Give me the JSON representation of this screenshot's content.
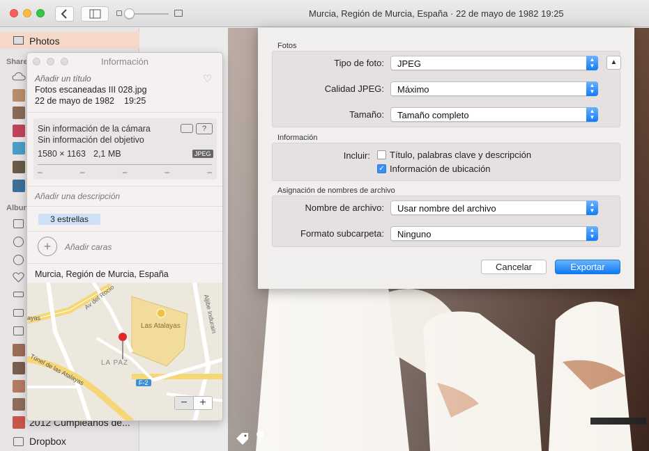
{
  "window": {
    "title": "Murcia, Región de Murcia, España  ·  22 de mayo de 1982 19:25"
  },
  "sidebar": {
    "photos_label": "Photos",
    "shared_heading": "Share",
    "albums_heading": "Albun",
    "birthday_album": "2012 Cumpleaños de...",
    "dropbox_label": "Dropbox"
  },
  "info": {
    "panel_title": "Información",
    "add_title_placeholder": "Añadir un título",
    "filename": "Fotos escaneadas III 028.jpg",
    "date": "22 de mayo de 1982",
    "time": "19:25",
    "no_camera": "Sin información de la cámara",
    "no_lens": "Sin información del objetivo",
    "dimensions": "1580 × 1163",
    "file_size": "2,1 MB",
    "format_badge": "JPEG",
    "camera_help": "?",
    "dashes": [
      "–",
      "–",
      "–",
      "–",
      "–"
    ],
    "add_description": "Añadir una descripción",
    "rating": "3 estrellas",
    "add_faces": "Añadir caras",
    "location": "Murcia, Región de Murcia, España",
    "map": {
      "street_1": "Av del Rocío",
      "street_2": "Aljibe Indurain",
      "place": "Las Atalayas",
      "district": "LA PAZ",
      "tunnel": "Túnel de las Atalayas",
      "road_badge": "F-2",
      "side_label": "ayas",
      "zoom_out": "−",
      "zoom_in": "+"
    }
  },
  "export": {
    "section_photos": "Fotos",
    "photo_type_label": "Tipo de foto:",
    "photo_type_value": "JPEG",
    "quality_label": "Calidad JPEG:",
    "quality_value": "Máximo",
    "size_label": "Tamaño:",
    "size_value": "Tamaño completo",
    "section_info": "Información",
    "include_label": "Incluir:",
    "include_title": "Título, palabras clave y descripción",
    "include_title_checked": false,
    "include_location": "Información de ubicación",
    "include_location_checked": true,
    "section_naming": "Asignación de nombres de archivo",
    "filename_label": "Nombre de archivo:",
    "filename_value": "Usar nombre del archivo",
    "subfolder_label": "Formato subcarpeta:",
    "subfolder_value": "Ninguno",
    "cancel_button": "Cancelar",
    "export_button": "Exportar"
  },
  "colors": {
    "accent": "#137bf5",
    "sidebar_selection": "#f5d8c8"
  }
}
